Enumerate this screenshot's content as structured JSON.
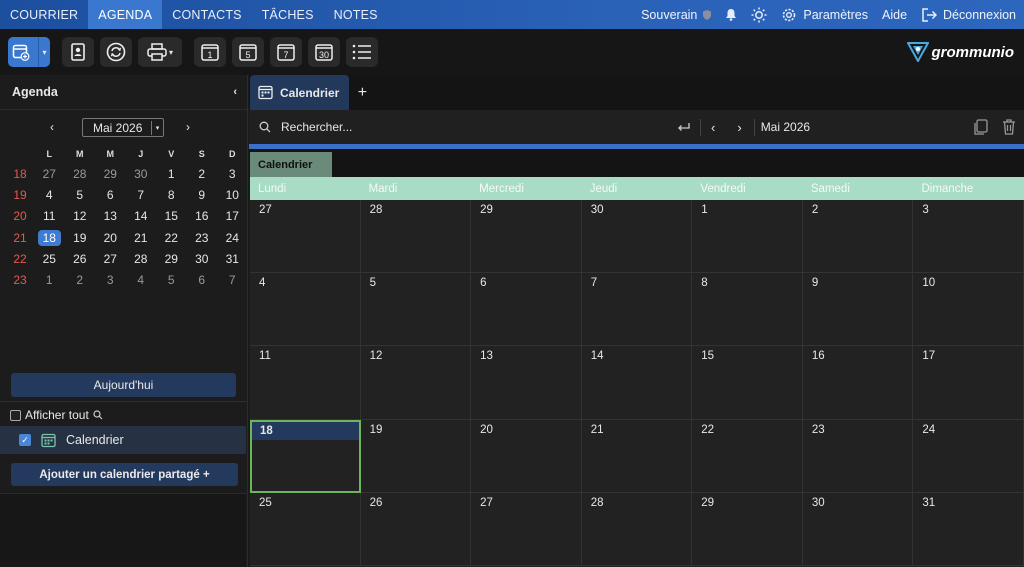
{
  "nav": {
    "tabs": [
      "COURRIER",
      "AGENDA",
      "CONTACTS",
      "TÂCHES",
      "NOTES"
    ],
    "active_tab": "AGENDA",
    "user": "Souverain",
    "settings": "Paramètres",
    "help": "Aide",
    "logout": "Déconnexion"
  },
  "toolbar": {
    "logo_text": "grommunio",
    "day_icons": [
      "1",
      "5",
      "7",
      "30"
    ]
  },
  "sidebar": {
    "title": "Agenda",
    "mini_month": "Mai 2026",
    "weekday_headers": [
      "L",
      "M",
      "M",
      "J",
      "V",
      "S",
      "D"
    ],
    "weeks": [
      {
        "wk": "18",
        "days": [
          "27",
          "28",
          "29",
          "30",
          "1",
          "2",
          "3"
        ]
      },
      {
        "wk": "19",
        "days": [
          "4",
          "5",
          "6",
          "7",
          "8",
          "9",
          "10"
        ]
      },
      {
        "wk": "20",
        "days": [
          "11",
          "12",
          "13",
          "14",
          "15",
          "16",
          "17"
        ]
      },
      {
        "wk": "21",
        "days": [
          "18",
          "19",
          "20",
          "21",
          "22",
          "23",
          "24"
        ]
      },
      {
        "wk": "22",
        "days": [
          "25",
          "26",
          "27",
          "28",
          "29",
          "30",
          "31"
        ]
      },
      {
        "wk": "23",
        "days": [
          "1",
          "2",
          "3",
          "4",
          "5",
          "6",
          "7"
        ]
      }
    ],
    "today_label": "Aujourd'hui",
    "show_all": "Afficher tout",
    "calendar_name": "Calendrier",
    "add_shared": "Ajouter un calendrier partagé +"
  },
  "main": {
    "tab_label": "Calendrier",
    "search_placeholder": "Rechercher...",
    "current_month": "Mai 2026",
    "calendar_label": "Calendrier",
    "weekdays": [
      "Lundi",
      "Mardi",
      "Mercredi",
      "Jeudi",
      "Vendredi",
      "Samedi",
      "Dimanche"
    ],
    "weeks": [
      [
        "27",
        "28",
        "29",
        "30",
        "1",
        "2",
        "3"
      ],
      [
        "4",
        "5",
        "6",
        "7",
        "8",
        "9",
        "10"
      ],
      [
        "11",
        "12",
        "13",
        "14",
        "15",
        "16",
        "17"
      ],
      [
        "18",
        "19",
        "20",
        "21",
        "22",
        "23",
        "24"
      ],
      [
        "25",
        "26",
        "27",
        "28",
        "29",
        "30",
        "31"
      ]
    ],
    "today": "18"
  },
  "colors": {
    "accent": "#3a78d0",
    "weekday_header_bg": "#a8dcc4",
    "today_border": "#6db559",
    "week_number": "#e25a4f"
  }
}
